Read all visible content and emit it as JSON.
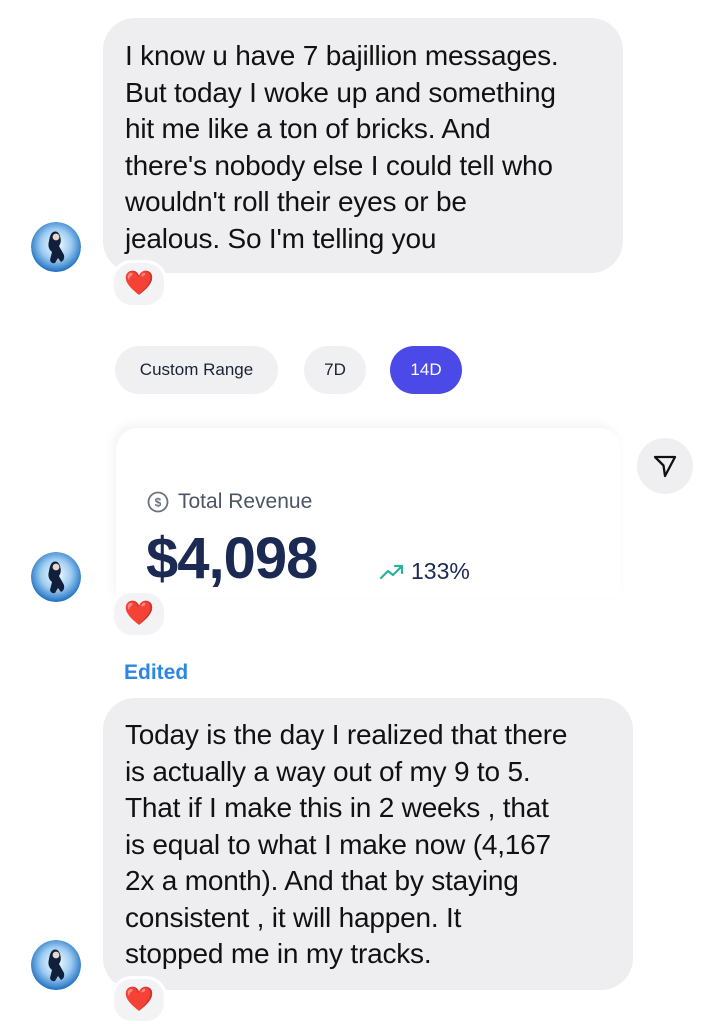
{
  "messages": [
    {
      "text": "I know u have 7 bajillion messages.\nBut today I woke up and something\nhit me like a ton of bricks. And\nthere's nobody else I could tell who\nwouldn't roll their eyes or be\njealous.  So I'm telling you",
      "reaction": "❤️"
    },
    {
      "reaction": "❤️",
      "edited_label": "Edited"
    },
    {
      "text": "Today is the day I realized that there\nis actually a way out of my 9 to 5.\nThat if I make this in 2 weeks , that\nis equal to what I make now (4,167\n2x a month).  And that by staying\nconsistent , it will happen.  It\nstopped me in my tracks.",
      "reaction": "❤️"
    }
  ],
  "screenshot": {
    "chips": [
      "Custom Range",
      "7D",
      "14D"
    ],
    "active_chip": "14D",
    "revenue_label": "Total Revenue",
    "revenue_value": "$4,098",
    "revenue_change": "133%",
    "accent_color": "#4b49e8",
    "value_color": "#1b2a52",
    "change_color": "#2bb39a"
  },
  "icons": {
    "forward": "paper-plane-icon",
    "reaction": "heart-icon",
    "dollar": "dollar-circle-icon",
    "trend": "trend-up-icon"
  }
}
